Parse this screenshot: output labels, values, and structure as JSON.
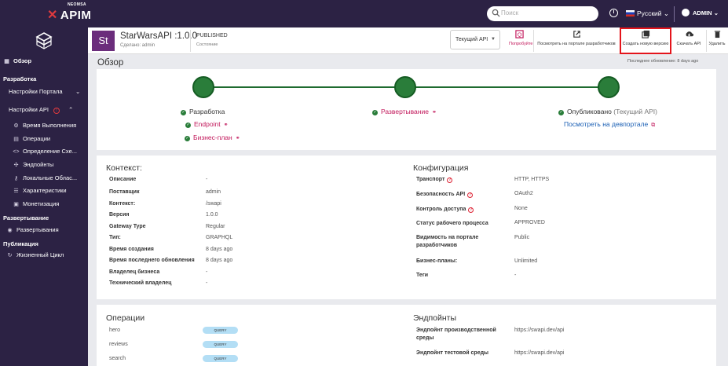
{
  "topbar": {
    "logo_small": "NEOMSA",
    "logo_main": "APIM",
    "search_placeholder": "Поиск",
    "language": "Русский",
    "user": "ADMIN"
  },
  "sidebar": {
    "overview": "Обзор",
    "dev_header": "Разработка",
    "portal_settings": "Настройки Портала",
    "api_settings": "Настройки API",
    "items": [
      {
        "label": "Время Выполнения"
      },
      {
        "label": "Операции"
      },
      {
        "label": "Определение Схе..."
      },
      {
        "label": "Эндпойнты"
      },
      {
        "label": "Локальные Облас..."
      },
      {
        "label": "Характеристики"
      },
      {
        "label": "Монетизация"
      }
    ],
    "deploy_header": "Развертывание",
    "deploy_item": "Развертывания",
    "publish_header": "Публикация",
    "publish_item": "Жизненный Цикл"
  },
  "api_header": {
    "avatar": "St",
    "name": "StarWarsAPI :1.0.0",
    "created_by": "Сделано: admin",
    "status": "PUBLISHED",
    "status_label": "Состояние",
    "current_api": "Текущий API",
    "actions": {
      "try": "Попробуйте",
      "view_portal": "Посмотреть на портале разработчиков",
      "new_version": "Создать новую версию",
      "download": "Скачать API",
      "delete": "Удалить"
    }
  },
  "overview": {
    "title": "Обзор",
    "last_updated": "Последнее обновление: 8 days ago",
    "lifecycle": {
      "dev": "Разработка",
      "endpoint": "Endpoint",
      "business_plan": "Бизнес-план",
      "deploy": "Развертывание",
      "published": "Опубликовано",
      "published_suffix": "(Текущий API)",
      "view_devportal": "Посмотреть на девпортале"
    }
  },
  "context": {
    "title": "Контекст:",
    "rows": [
      {
        "k": "Описание",
        "v": "-"
      },
      {
        "k": "Поставщик",
        "v": "admin"
      },
      {
        "k": "Контекст:",
        "v": "/swapi"
      },
      {
        "k": "Версия",
        "v": "1.0.0"
      },
      {
        "k": "Gateway Type",
        "v": "Regular"
      },
      {
        "k": "Тип:",
        "v": "GRAPHQL"
      },
      {
        "k": "Время создания",
        "v": "8 days ago"
      },
      {
        "k": "Время последнего обновления",
        "v": "8 days ago"
      },
      {
        "k": "Владелец бизнеса",
        "v": "-"
      },
      {
        "k": "Технический владелец",
        "v": "-"
      }
    ]
  },
  "config": {
    "title": "Конфигурация",
    "rows": [
      {
        "k": "Транспорт",
        "v": "HTTP, HTTPS"
      },
      {
        "k": "Безопасность API",
        "v": "OAuth2"
      },
      {
        "k": "Контроль доступа",
        "v": "None"
      },
      {
        "k": "Статус рабочего процесса",
        "v": "APPROVED"
      },
      {
        "k": "Видимость на портале",
        "k2": "разработчиков",
        "v": "Public"
      },
      {
        "k": "Бизнес-планы:",
        "v": "Unlimited"
      },
      {
        "k": "Теги",
        "v": "-"
      }
    ]
  },
  "operations": {
    "title": "Операции",
    "items": [
      {
        "name": "hero",
        "type": "QUERY"
      },
      {
        "name": "reviews",
        "type": "QUERY"
      },
      {
        "name": "search",
        "type": "QUERY"
      }
    ]
  },
  "endpoints": {
    "title": "Эндпойнты",
    "rows": [
      {
        "k": "Эндпойнт производственной",
        "k2": "среды",
        "v": "https://swapi.dev/api"
      },
      {
        "k": "Эндпойнт тестовой среды",
        "v": "https://swapi.dev/api"
      }
    ]
  }
}
